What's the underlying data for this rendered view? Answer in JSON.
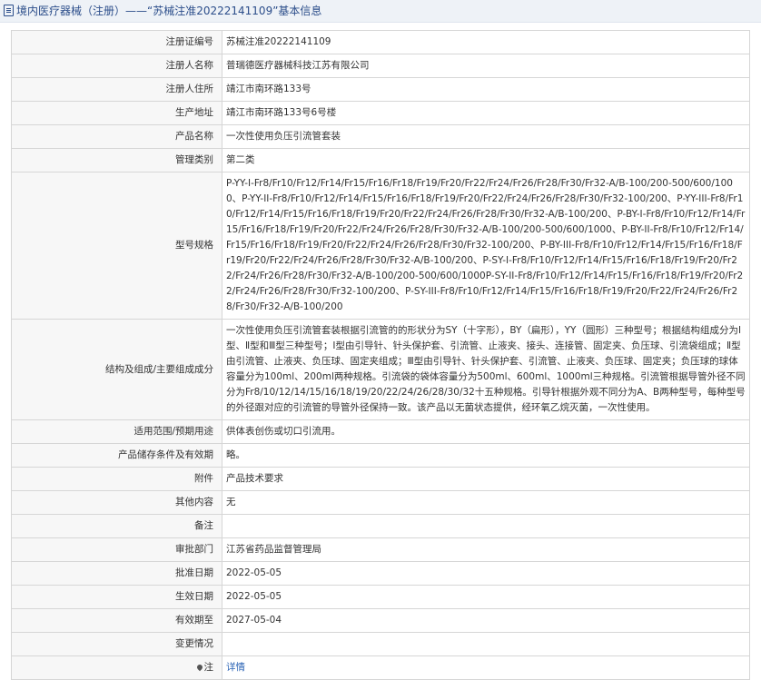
{
  "header": {
    "title": "境内医疗器械（注册）——“苏械注准20222141109”基本信息"
  },
  "rows": {
    "reg_no": {
      "label": "注册证编号",
      "value": "苏械注准20222141109"
    },
    "registrant": {
      "label": "注册人名称",
      "value": "普瑞德医疗器械科技江苏有限公司"
    },
    "registrant_addr": {
      "label": "注册人住所",
      "value": "靖江市南环路133号"
    },
    "production_addr": {
      "label": "生产地址",
      "value": "靖江市南环路133号6号楼"
    },
    "product_name": {
      "label": "产品名称",
      "value": "一次性使用负压引流管套装"
    },
    "category": {
      "label": "管理类别",
      "value": "第二类"
    },
    "models": {
      "label": "型号规格",
      "value": "P-YY-I-Fr8/Fr10/Fr12/Fr14/Fr15/Fr16/Fr18/Fr19/Fr20/Fr22/Fr24/Fr26/Fr28/Fr30/Fr32-A/B-100/200-500/600/1000、P-YY-II-Fr8/Fr10/Fr12/Fr14/Fr15/Fr16/Fr18/Fr19/Fr20/Fr22/Fr24/Fr26/Fr28/Fr30/Fr32-100/200、P-YY-III-Fr8/Fr10/Fr12/Fr14/Fr15/Fr16/Fr18/Fr19/Fr20/Fr22/Fr24/Fr26/Fr28/Fr30/Fr32-A/B-100/200、P-BY-I-Fr8/Fr10/Fr12/Fr14/Fr15/Fr16/Fr18/Fr19/Fr20/Fr22/Fr24/Fr26/Fr28/Fr30/Fr32-A/B-100/200-500/600/1000、P-BY-II-Fr8/Fr10/Fr12/Fr14/Fr15/Fr16/Fr18/Fr19/Fr20/Fr22/Fr24/Fr26/Fr28/Fr30/Fr32-100/200、P-BY-III-Fr8/Fr10/Fr12/Fr14/Fr15/Fr16/Fr18/Fr19/Fr20/Fr22/Fr24/Fr26/Fr28/Fr30/Fr32-A/B-100/200、P-SY-I-Fr8/Fr10/Fr12/Fr14/Fr15/Fr16/Fr18/Fr19/Fr20/Fr22/Fr24/Fr26/Fr28/Fr30/Fr32-A/B-100/200-500/600/1000P-SY-II-Fr8/Fr10/Fr12/Fr14/Fr15/Fr16/Fr18/Fr19/Fr20/Fr22/Fr24/Fr26/Fr28/Fr30/Fr32-100/200、P-SY-III-Fr8/Fr10/Fr12/Fr14/Fr15/Fr16/Fr18/Fr19/Fr20/Fr22/Fr24/Fr26/Fr28/Fr30/Fr32-A/B-100/200"
    },
    "structure": {
      "label": "结构及组成/主要组成成分",
      "value": "一次性使用负压引流管套装根据引流管的的形状分为SY（十字形），BY（扁形），YY（圆形）三种型号；根据结构组成分为Ⅰ型、Ⅱ型和Ⅲ型三种型号；Ⅰ型由引导针、针头保护套、引流管、止液夹、接头、连接管、固定夹、负压球、引流袋组成；Ⅱ型由引流管、止液夹、负压球、固定夹组成；Ⅲ型由引导针、针头保护套、引流管、止液夹、负压球、固定夹；负压球的球体容量分为100ml、200ml两种规格。引流袋的袋体容量分为500ml、600ml、1000ml三种规格。引流管根据导管外径不同分为Fr8/10/12/14/15/16/18/19/20/22/24/26/28/30/32十五种规格。引导针根据外观不同分为A、B两种型号，每种型号的外径跟对应的引流管的导管外径保持一致。该产品以无菌状态提供，经环氧乙烷灭菌，一次性使用。"
    },
    "scope": {
      "label": "适用范围/预期用途",
      "value": "供体表创伤或切口引流用。"
    },
    "storage": {
      "label": "产品储存条件及有效期",
      "value": "略。"
    },
    "attachment": {
      "label": "附件",
      "value": "产品技术要求"
    },
    "other": {
      "label": "其他内容",
      "value": "无"
    },
    "remark": {
      "label": "备注",
      "value": ""
    },
    "approval_dept": {
      "label": "审批部门",
      "value": "江苏省药品监督管理局"
    },
    "approval_date": {
      "label": "批准日期",
      "value": "2022-05-05"
    },
    "effective_date": {
      "label": "生效日期",
      "value": "2022-05-05"
    },
    "expiry_date": {
      "label": "有效期至",
      "value": "2027-05-04"
    },
    "changes": {
      "label": "变更情况",
      "value": ""
    },
    "note": {
      "label": "注",
      "value": "详情",
      "icon": "pin-icon"
    }
  }
}
